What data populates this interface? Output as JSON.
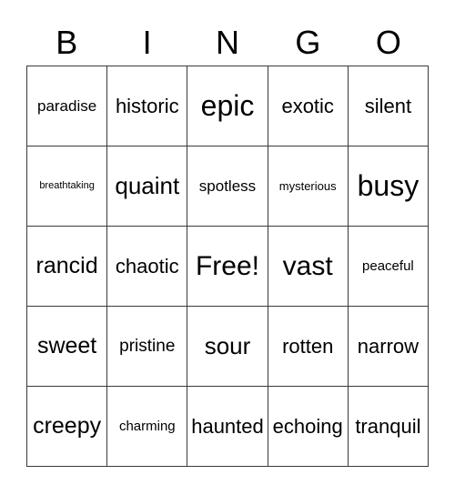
{
  "card": {
    "title_letters": [
      "B",
      "I",
      "N",
      "G",
      "O"
    ],
    "grid_size": "5x5",
    "free_space_label": "Free!",
    "colors": {
      "background": "#ffffff",
      "text": "#000000",
      "border": "#3a3a3a"
    },
    "columns": [
      {
        "letter": "B",
        "cells": [
          {
            "text": "paradise",
            "size": "fs-s"
          },
          {
            "text": "breathtaking",
            "size": "fs-tiny"
          },
          {
            "text": "rancid",
            "size": "fs-ml"
          },
          {
            "text": "sweet",
            "size": "fs-ml"
          },
          {
            "text": "creepy",
            "size": "fs-ml"
          }
        ]
      },
      {
        "letter": "I",
        "cells": [
          {
            "text": "historic",
            "size": "fs-m"
          },
          {
            "text": "quaint",
            "size": "fs-l"
          },
          {
            "text": "chaotic",
            "size": "fs-m"
          },
          {
            "text": "pristine",
            "size": "fs-sm"
          },
          {
            "text": "charming",
            "size": "fs-xs"
          }
        ]
      },
      {
        "letter": "N",
        "cells": [
          {
            "text": "epic",
            "size": "fs-xxl"
          },
          {
            "text": "spotless",
            "size": "fs-s"
          },
          {
            "text": "Free!",
            "size": "fs-xl"
          },
          {
            "text": "sour",
            "size": "fs-l"
          },
          {
            "text": "haunted",
            "size": "fs-m"
          }
        ]
      },
      {
        "letter": "G",
        "cells": [
          {
            "text": "exotic",
            "size": "fs-m"
          },
          {
            "text": "mysterious",
            "size": "fs-xxs"
          },
          {
            "text": "vast",
            "size": "fs-xl"
          },
          {
            "text": "rotten",
            "size": "fs-m"
          },
          {
            "text": "echoing",
            "size": "fs-m"
          }
        ]
      },
      {
        "letter": "O",
        "cells": [
          {
            "text": "silent",
            "size": "fs-m"
          },
          {
            "text": "busy",
            "size": "fs-xxl"
          },
          {
            "text": "peaceful",
            "size": "fs-xs"
          },
          {
            "text": "narrow",
            "size": "fs-m"
          },
          {
            "text": "tranquil",
            "size": "fs-m"
          }
        ]
      }
    ],
    "rows": [
      [
        "paradise",
        "historic",
        "epic",
        "exotic",
        "silent"
      ],
      [
        "breathtaking",
        "quaint",
        "spotless",
        "mysterious",
        "busy"
      ],
      [
        "rancid",
        "chaotic",
        "Free!",
        "vast",
        "peaceful"
      ],
      [
        "sweet",
        "pristine",
        "sour",
        "rotten",
        "narrow"
      ],
      [
        "creepy",
        "charming",
        "haunted",
        "echoing",
        "tranquil"
      ]
    ]
  }
}
